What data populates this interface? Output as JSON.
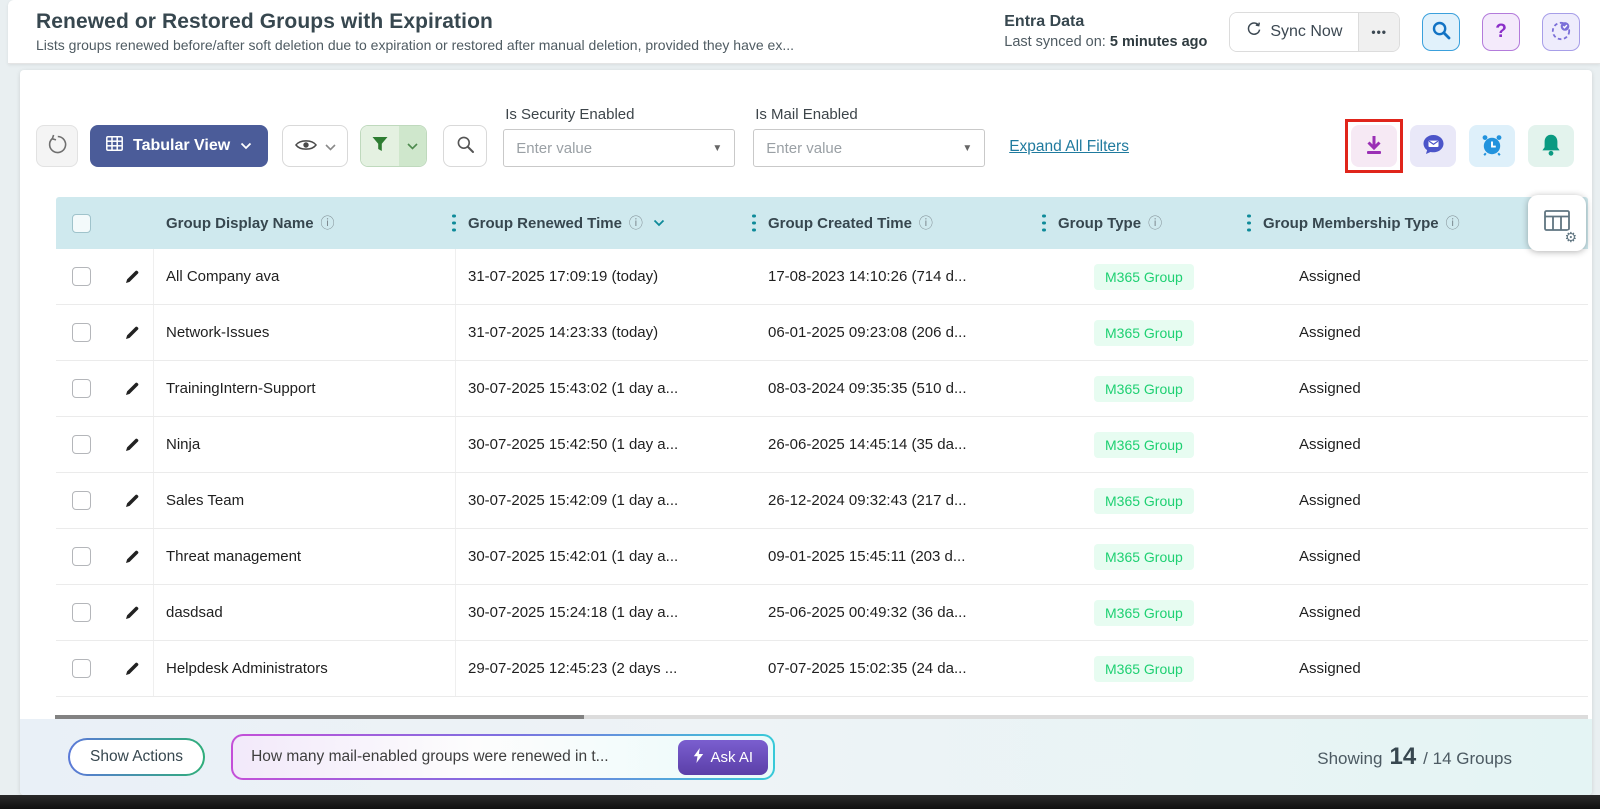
{
  "header": {
    "title": "Renewed or Restored Groups with Expiration",
    "subtitle": "Lists groups renewed before/after soft deletion due to expiration or restored after manual deletion, provided they have ex...",
    "source_name": "Entra Data",
    "last_synced_label": "Last synced on:",
    "last_synced_value": "5 minutes ago",
    "sync_button_label": "Sync Now",
    "more_button_glyph": "•••",
    "help_glyph": "?"
  },
  "toolbar": {
    "view_button_label": "Tabular View",
    "filters": [
      {
        "label": "Is Security Enabled",
        "placeholder": "Enter value"
      },
      {
        "label": "Is Mail Enabled",
        "placeholder": "Enter value"
      }
    ],
    "expand_link": "Expand All Filters"
  },
  "table": {
    "columns": [
      {
        "label": "Group Display Name",
        "info": true,
        "sorted": false,
        "kebab": true
      },
      {
        "label": "Group Renewed Time",
        "info": true,
        "sorted": true,
        "kebab": true
      },
      {
        "label": "Group Created Time",
        "info": true,
        "sorted": false,
        "kebab": true
      },
      {
        "label": "Group Type",
        "info": true,
        "sorted": false,
        "kebab": true
      },
      {
        "label": "Group Membership Type",
        "info": true,
        "sorted": false,
        "kebab": false
      }
    ],
    "rows": [
      {
        "name": "All Company ava",
        "renewed": "31-07-2025 17:09:19 (today)",
        "created": "17-08-2023 14:10:26 (714 d...",
        "type": "M365 Group",
        "membership": "Assigned"
      },
      {
        "name": "Network-Issues",
        "renewed": "31-07-2025 14:23:33 (today)",
        "created": "06-01-2025 09:23:08 (206 d...",
        "type": "M365 Group",
        "membership": "Assigned"
      },
      {
        "name": "TrainingIntern-Support",
        "renewed": "30-07-2025 15:43:02 (1 day a...",
        "created": "08-03-2024 09:35:35 (510 d...",
        "type": "M365 Group",
        "membership": "Assigned"
      },
      {
        "name": "Ninja",
        "renewed": "30-07-2025 15:42:50 (1 day a...",
        "created": "26-06-2025 14:45:14 (35 da...",
        "type": "M365 Group",
        "membership": "Assigned"
      },
      {
        "name": "Sales Team",
        "renewed": "30-07-2025 15:42:09 (1 day a...",
        "created": "26-12-2024 09:32:43 (217 d...",
        "type": "M365 Group",
        "membership": "Assigned"
      },
      {
        "name": "Threat management",
        "renewed": "30-07-2025 15:42:01 (1 day a...",
        "created": "09-01-2025 15:45:11 (203 d...",
        "type": "M365 Group",
        "membership": "Assigned"
      },
      {
        "name": "dasdsad",
        "renewed": "30-07-2025 15:24:18 (1 day a...",
        "created": "25-06-2025 00:49:32 (36 da...",
        "type": "M365 Group",
        "membership": "Assigned"
      },
      {
        "name": "Helpdesk Administrators",
        "renewed": "29-07-2025 12:45:23 (2 days ...",
        "created": "07-07-2025 15:02:35 (24 da...",
        "type": "M365 Group",
        "membership": "Assigned"
      }
    ]
  },
  "footer": {
    "show_actions_label": "Show Actions",
    "ai_query": "How many mail-enabled groups were renewed in t...",
    "ask_ai_label": "Ask AI",
    "showing_label": "Showing",
    "shown_count": "14",
    "total_suffix": "/ 14 Groups"
  },
  "colors": {
    "accent_teal": "#0e8a99",
    "header_bg": "#cfe9ee",
    "view_button": "#4b5c99",
    "badge_green_text": "#1ed072",
    "badge_green_bg": "#e7fcf1",
    "highlight_red": "#e0251b"
  }
}
